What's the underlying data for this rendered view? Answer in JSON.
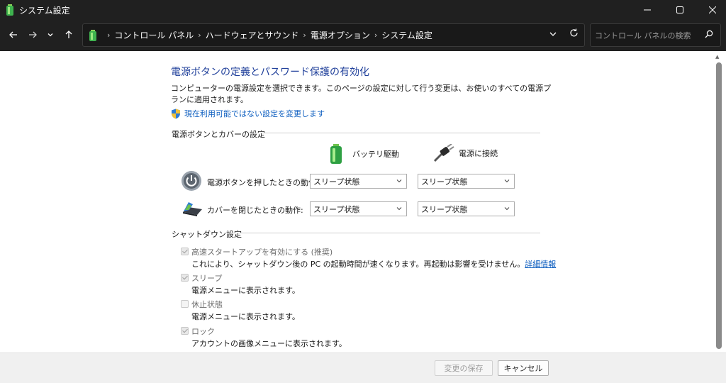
{
  "window": {
    "title": "システム設定",
    "controls": {
      "minimize": "minimize-icon",
      "maximize": "maximize-icon",
      "close": "close-icon"
    }
  },
  "nav": {
    "back": "back-arrow-icon",
    "forward": "forward-arrow-icon",
    "recent": "chevron-down-icon",
    "up": "up-arrow-icon"
  },
  "breadcrumbs": [
    "コントロール パネル",
    "ハードウェアとサウンド",
    "電源オプション",
    "システム設定"
  ],
  "search": {
    "placeholder": "コントロール パネルの検索"
  },
  "page": {
    "title": "電源ボタンの定義とパスワード保護の有効化",
    "intro": "コンピューターの電源設定を選択できます。このページの設定に対して行う変更は、お使いのすべての電源プランに適用されます。",
    "uac_link": "現在利用可能ではない設定を変更します"
  },
  "power_group": {
    "title": "電源ボタンとカバーの設定",
    "col_battery": "バッテリ駆動",
    "col_plugged": "電源に接続",
    "rows": [
      {
        "label": "電源ボタンを押したときの動作:",
        "battery": "スリープ状態",
        "plugged": "スリープ状態"
      },
      {
        "label": "カバーを閉じたときの動作:",
        "battery": "スリープ状態",
        "plugged": "スリープ状態"
      }
    ]
  },
  "shutdown_group": {
    "title": "シャットダウン設定",
    "items": [
      {
        "label": "高速スタートアップを有効にする (推奨)",
        "desc": "これにより、シャットダウン後の PC の起動時間が速くなります。再起動は影響を受けません。",
        "link": "詳細情報",
        "checked": true
      },
      {
        "label": "スリープ",
        "desc": "電源メニューに表示されます。",
        "checked": true
      },
      {
        "label": "休止状態",
        "desc": "電源メニューに表示されます。",
        "checked": false
      },
      {
        "label": "ロック",
        "desc": "アカウントの画像メニューに表示されます。",
        "checked": true
      }
    ]
  },
  "footer": {
    "save": "変更の保存",
    "cancel": "キャンセル"
  },
  "colors": {
    "titlebar": "#202020",
    "link": "#1060c0",
    "heading": "#1f3f9a"
  }
}
